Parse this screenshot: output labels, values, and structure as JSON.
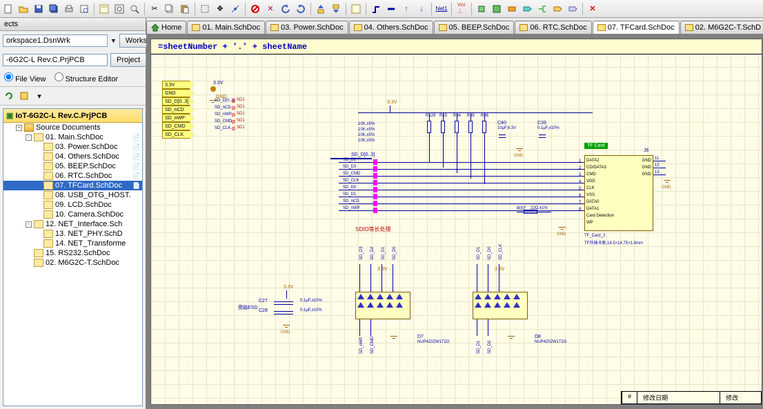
{
  "toolbar": {
    "icons": [
      "new",
      "open",
      "save",
      "stack",
      "print",
      "preview",
      "",
      "zoom-fit",
      "zoom-in",
      "zoom-out",
      "",
      "cut",
      "copy",
      "paste",
      "",
      "marquee",
      "cross",
      "snap",
      "",
      "deny",
      "link",
      "undo",
      "redo",
      "",
      "switch",
      "align",
      "",
      "layer",
      "",
      "wave",
      "down-blue",
      "up-blue",
      "down-blue2",
      "",
      "net",
      "",
      "vcc",
      "",
      "dot-green",
      "box-green",
      "box-orange",
      "cyan",
      "plus",
      "right-arrow",
      "right-arrow2",
      "",
      "x-red",
      ""
    ]
  },
  "panel": {
    "title": "ects",
    "workspace_value": "orkspace1.DsnWrk",
    "workspace_btn": "Workspace",
    "project_value": "-6G2C-L Rev.C.PrjPCB",
    "project_btn": "Project",
    "view_file": "File View",
    "view_struct": "Structure Editor"
  },
  "tree": {
    "root": "IoT-6G2C-L Rev.C.PrjPCB",
    "source": "Source Documents",
    "items": [
      {
        "label": "01. Main.SchDoc",
        "indent": 2,
        "expander": "-",
        "status": "📄"
      },
      {
        "label": "03. Power.SchDoc",
        "indent": 3,
        "status": "📄"
      },
      {
        "label": "04. Others.SchDoc",
        "indent": 3,
        "status": "📄"
      },
      {
        "label": "05. BEEP.SchDoc",
        "indent": 3,
        "status": "📄"
      },
      {
        "label": "06. RTC.SchDoc",
        "indent": 3,
        "status": "📄"
      },
      {
        "label": "07. TFCard.SchDoc",
        "indent": 3,
        "selected": true,
        "status": "📄"
      },
      {
        "label": "08. USB_OTG_HOST.",
        "indent": 3
      },
      {
        "label": "09. LCD.SchDoc",
        "indent": 3
      },
      {
        "label": "10. Camera.SchDoc",
        "indent": 3
      },
      {
        "label": "12. NET_Interface.Sch",
        "indent": 2,
        "expander": "-"
      },
      {
        "label": "13. NET_PHY.SchD",
        "indent": 3
      },
      {
        "label": "14. NET_Transforme",
        "indent": 3
      },
      {
        "label": "15. RS232.SchDoc",
        "indent": 2
      },
      {
        "label": "02. M6G2C-T.SchDoc",
        "indent": 2
      }
    ]
  },
  "tabs": [
    {
      "label": "Home",
      "icon": "home"
    },
    {
      "label": "01. Main.SchDoc"
    },
    {
      "label": "03. Power.SchDoc"
    },
    {
      "label": "04. Others.SchDoc"
    },
    {
      "label": "05. BEEP.SchDoc"
    },
    {
      "label": "06. RTC.SchDoc"
    },
    {
      "label": "07. TFCard.SchDoc",
      "active": true
    },
    {
      "label": "02. M6G2C-T.SchD"
    }
  ],
  "sheet": {
    "title": "=sheetNumber + '.' + sheetName",
    "ports": [
      "3.3V",
      "GND",
      "SD_D[0..3]",
      "SD_nCD",
      "SD_nWP",
      "SD_CMD",
      "SD_CLK"
    ],
    "net_bus": "SD_D[0..3]",
    "nets": [
      "SD_D2",
      "SD_D3",
      "SD_CMD",
      "SD_CLK",
      "SD_D0",
      "SD_D1",
      "SD_nCD",
      "SD_nWP"
    ],
    "pwr_labels": {
      "v33": "3.3V",
      "gnd": "GND"
    },
    "noerc": "SD1",
    "r_vals": "10K,±5%",
    "r_refs": [
      "R129",
      "R33",
      "R34",
      "R35",
      "R36"
    ],
    "caps": [
      {
        "ref": "C40",
        "val": "10μF,6.3V"
      },
      {
        "ref": "C39",
        "val": "0.1μF,±10%"
      }
    ],
    "tfcard_title": "TF Card",
    "j6_ref": "J6",
    "j6_pins_left": [
      "DATA2",
      "CD/DATA3",
      "CMD",
      "VDD",
      "CLK",
      "VSS",
      "DATA0",
      "DATA1",
      "Card Detection",
      "WP"
    ],
    "j6_pins_right": [
      "GND",
      "GND",
      "GND"
    ],
    "j6_pins_right_num": [
      "11",
      "12",
      "13"
    ],
    "j6_note1": "TF_Card_2",
    "j6_note2": "TF外插卡座,14.5×14.75×1.8mm",
    "r37": "R37",
    "r37_note": "22Ω,±1%",
    "sdio_note": "SDIO等长处理",
    "esd_note": "旁路ESD",
    "c27": "C27",
    "c28": "C28",
    "c27_val": "0.1μF,±10%",
    "c28_val": "0.1μF,±10%",
    "d7": {
      "ref": "D7",
      "part": "NUP4202W1T2G"
    },
    "d8": {
      "ref": "D8",
      "part": "NUP4202W1T2G"
    },
    "esd_nets_left": [
      "SD_D3",
      "SD_D2",
      "SD_D1",
      "SD_D0"
    ],
    "esd_nets_left_bot": [
      "SD_nWP",
      "SD_CMD"
    ],
    "esd_nets_right": [
      "SD_D1",
      "SD_D0",
      "SD_CLK"
    ],
    "esd_nets_right_bot": [
      "SD_D1",
      "SD_D0"
    ],
    "change_hdr": [
      "#",
      "修改日期",
      "修改"
    ]
  }
}
